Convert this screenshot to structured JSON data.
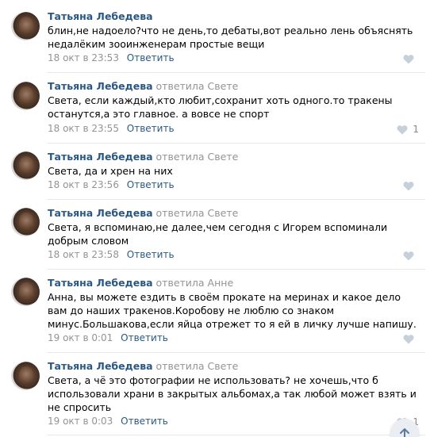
{
  "comments": [
    {
      "author": "Татьяна Лебедева",
      "reply_to": "",
      "text": "блин,не надоело?что не день,то дебаты,вот реально лень объяснять недалёким зооинженерам простые вещи",
      "date": "18 окт в 23:53",
      "reply_label": "Ответить",
      "likes": ""
    },
    {
      "author": "Татьяна Лебедева",
      "reply_to": "ответила Свете",
      "text": "Света, если каждый,кто любит,сохранит хоть одного.то тракены останутся,а это главное. а вовсе не спорт",
      "date": "18 окт в 23:55",
      "reply_label": "Ответить",
      "likes": "1"
    },
    {
      "author": "Татьяна Лебедева",
      "reply_to": "ответила Свете",
      "text": "Света, да и хрен на них",
      "date": "18 окт в 23:56",
      "reply_label": "Ответить",
      "likes": ""
    },
    {
      "author": "Татьяна Лебедева",
      "reply_to": "ответила Свете",
      "text": "Света, я вспоминаю,не далее,чем сегодня с Игорем вспоминали добрым словом",
      "date": "18 окт в 23:58",
      "reply_label": "Ответить",
      "likes": ""
    },
    {
      "author": "Татьяна Лебедева",
      "reply_to": "ответила Анне",
      "text": "Анна, вы можете ездить в своём прокате на меринах и какое дело вам до наших тракенов.Коробову не люблю со знаком минус.Большакова,если яйца отрежет то я ей в личку лучше напишу.",
      "date": "19 окт в 0:01",
      "reply_label": "Ответить",
      "likes": ""
    },
    {
      "author": "Татьяна Лебедева",
      "reply_to": "ответила Свете",
      "text": "Света, а чё это фотографии не использовать? не хочешь,что б использовали храни в закрытых альбомах,а так любой может взять и не спросить",
      "date": "19 окт в 0:03",
      "reply_label": "Ответить",
      "likes": "1"
    }
  ]
}
